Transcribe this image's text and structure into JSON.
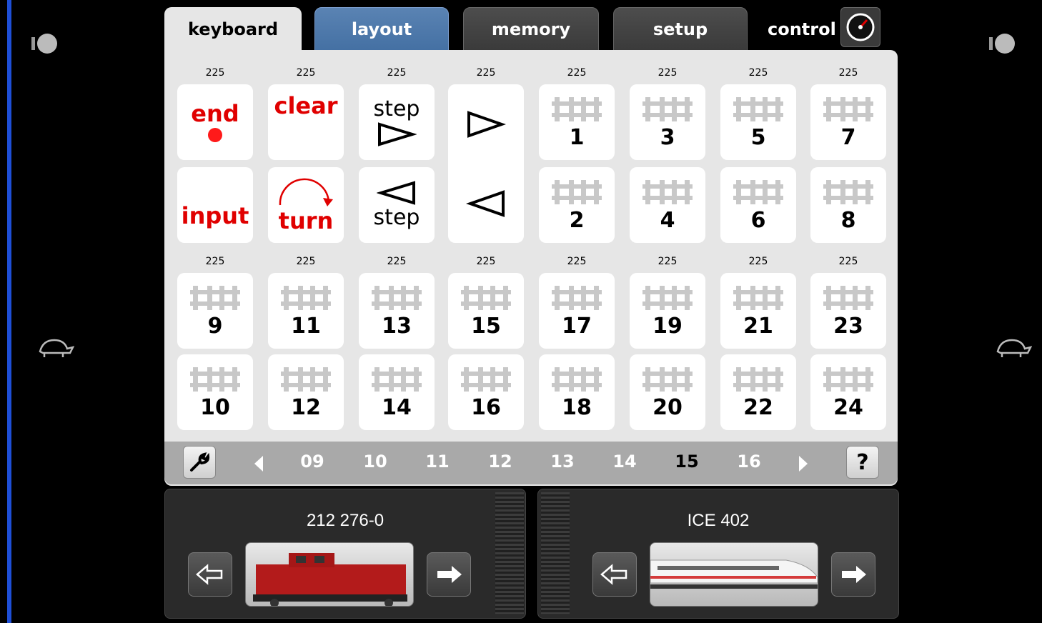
{
  "tabs": [
    {
      "label": "keyboard"
    },
    {
      "label": "layout"
    },
    {
      "label": "memory"
    },
    {
      "label": "setup"
    },
    {
      "label": "control"
    }
  ],
  "top_labels": [
    "225",
    "225",
    "225",
    "225",
    "225",
    "225",
    "225",
    "225"
  ],
  "bottom_labels": [
    "225",
    "225",
    "225",
    "225",
    "225",
    "225",
    "225",
    "225"
  ],
  "keys": {
    "end": "end",
    "clear": "clear",
    "step_fwd": "step",
    "step_back": "step",
    "input": "input",
    "turn": "turn"
  },
  "switch_row1": [
    "1",
    "3",
    "5",
    "7"
  ],
  "switch_row2": [
    "2",
    "4",
    "6",
    "8"
  ],
  "switch_row3": [
    "9",
    "11",
    "13",
    "15",
    "17",
    "19",
    "21",
    "23"
  ],
  "switch_row4": [
    "10",
    "12",
    "14",
    "16",
    "18",
    "20",
    "22",
    "24"
  ],
  "pager": {
    "pages": [
      "09",
      "10",
      "11",
      "12",
      "13",
      "14",
      "15",
      "16"
    ],
    "active": "15",
    "help": "?"
  },
  "locomotives": [
    {
      "name": "212 276-0"
    },
    {
      "name": "ICE 402"
    }
  ],
  "colors": {
    "accent_red": "#e00000",
    "tab_layout_blue": "#4a76a8",
    "panel_bg": "#e6e6e6"
  }
}
